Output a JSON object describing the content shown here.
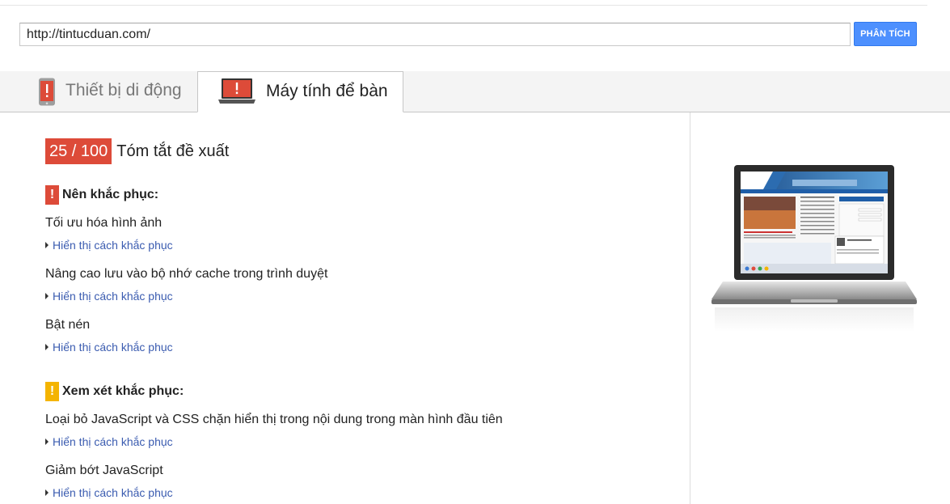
{
  "url_bar": {
    "value": "http://tintucduan.com/",
    "button_label": "PHÂN TÍCH"
  },
  "tabs": [
    {
      "label": "Thiết bị di động",
      "icon": "mobile-phone-icon",
      "active": false
    },
    {
      "label": "Máy tính để bàn",
      "icon": "laptop-icon",
      "active": true
    }
  ],
  "summary": {
    "score": "25 / 100",
    "title": "Tóm tắt đề xuất"
  },
  "sections": [
    {
      "title": "Nên khắc phục:",
      "icon_glyph": "!",
      "severity_color": "#dd4b39",
      "rules": [
        {
          "title": "Tối ưu hóa hình ảnh",
          "link": "Hiển thị cách khắc phục"
        },
        {
          "title": "Nâng cao lưu vào bộ nhớ cache trong trình duyệt",
          "link": "Hiển thị cách khắc phục"
        },
        {
          "title": "Bật nén",
          "link": "Hiển thị cách khắc phục"
        }
      ]
    },
    {
      "title": "Xem xét khắc phục:",
      "icon_glyph": "!",
      "severity_color": "#f4b400",
      "rules": [
        {
          "title": "Loại bỏ JavaScript và CSS chặn hiển thị trong nội dung trong màn hình đầu tiên",
          "link": "Hiển thị cách khắc phục"
        },
        {
          "title": "Giảm bớt JavaScript",
          "link": "Hiển thị cách khắc phục"
        }
      ]
    }
  ],
  "colors": {
    "accent": "#4d90fe",
    "link": "#3b5cb0",
    "score_bad": "#dd4b39"
  }
}
